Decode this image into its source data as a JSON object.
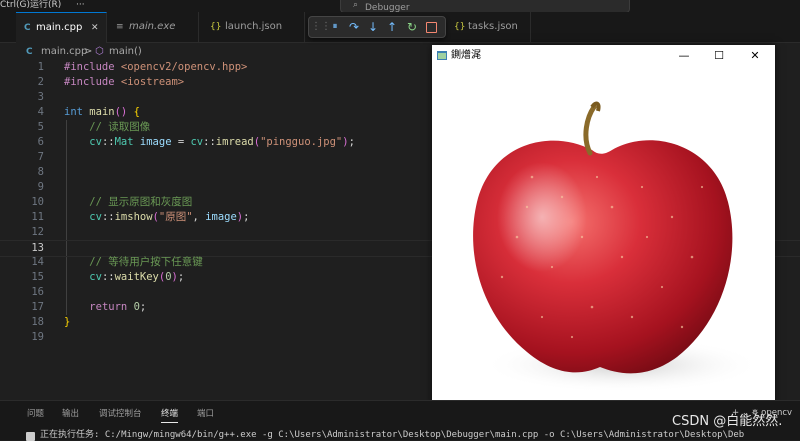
{
  "menu": {
    "item1": "Ctrl(G)",
    "item2": "运行(R)",
    "more": "···"
  },
  "command_center": {
    "label": "Debugger [管理员]"
  },
  "tabs": [
    {
      "label": "main.cpp",
      "icon": "C"
    },
    {
      "label": "main.exe",
      "icon": "≡"
    },
    {
      "label": "launch.json",
      "icon": "{}"
    },
    {
      "label": "tasks.json",
      "icon": "{}"
    }
  ],
  "tab_close": "✕",
  "debug_toolbar": {
    "continue": "⏸",
    "step_over": "↷",
    "step_into": "↓",
    "step_out": "↑",
    "restart": "↻",
    "stop": "■"
  },
  "breadcrumb": {
    "file": "main.cpp",
    "sep": ">",
    "symbol": "main()"
  },
  "code": [
    {
      "n": "1",
      "text": "#include <opencv2/opencv.hpp>"
    },
    {
      "n": "2",
      "text": "#include <iostream>"
    },
    {
      "n": "3",
      "text": ""
    },
    {
      "n": "4",
      "text": "int main() {"
    },
    {
      "n": "5",
      "text": "    // 读取图像"
    },
    {
      "n": "6",
      "text": "    cv::Mat image = cv::imread(\"pingguo.jpg\");"
    },
    {
      "n": "7",
      "text": ""
    },
    {
      "n": "8",
      "text": ""
    },
    {
      "n": "9",
      "text": ""
    },
    {
      "n": "10",
      "text": "    // 显示原图和灰度图"
    },
    {
      "n": "11",
      "text": "    cv::imshow(\"原图\", image);"
    },
    {
      "n": "12",
      "text": ""
    },
    {
      "n": "13",
      "text": ""
    },
    {
      "n": "14",
      "text": "    // 等待用户按下任意键"
    },
    {
      "n": "15",
      "text": "    cv::waitKey(0);"
    },
    {
      "n": "16",
      "text": ""
    },
    {
      "n": "17",
      "text": "    return 0;"
    },
    {
      "n": "18",
      "text": "}"
    },
    {
      "n": "19",
      "text": ""
    }
  ],
  "image_window": {
    "title": "鍘熷浘",
    "minimize": "—",
    "maximize": "☐",
    "close": "✕"
  },
  "panel": {
    "tabs": [
      "问题",
      "输出",
      "调试控制台",
      "终端",
      "端口"
    ],
    "terminal_line": "正在执行任务: C:/Mingw/mingw64/bin/g++.exe -g C:\\Users\\Administrator\\Desktop\\Debugger\\main.cpp -o C:\\Users\\Administrator\\Desktop\\Deb",
    "right_tools": "+ ⌄ ⛯ opencv"
  },
  "watermark": "CSDN @白能然然."
}
